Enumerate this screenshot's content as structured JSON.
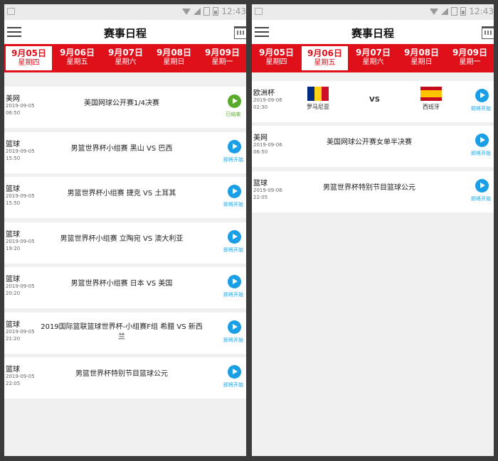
{
  "status": {
    "time": "12:43"
  },
  "header": {
    "title": "赛事日程"
  },
  "date_tabs": [
    {
      "date": "9月05日",
      "weekday": "星期四"
    },
    {
      "date": "9月06日",
      "weekday": "星期五"
    },
    {
      "date": "9月07日",
      "weekday": "星期六"
    },
    {
      "date": "9月08日",
      "weekday": "星期日"
    },
    {
      "date": "9月09日",
      "weekday": "星期一"
    }
  ],
  "left": {
    "active_tab": 0,
    "events": [
      {
        "sport": "美网",
        "date": "2019-09-05",
        "time": "06:50",
        "title": "美国网球公开赛1/4决赛",
        "status": "已结束"
      },
      {
        "sport": "篮球",
        "date": "2019-09-05",
        "time": "15:50",
        "title": "男篮世界杯小组赛 黑山 VS 巴西",
        "status": "即将开始"
      },
      {
        "sport": "篮球",
        "date": "2019-09-05",
        "time": "15:50",
        "title": "男篮世界杯小组赛 捷克 VS 土耳其",
        "status": "即将开始"
      },
      {
        "sport": "篮球",
        "date": "2019-09-05",
        "time": "19:20",
        "title": "男篮世界杯小组赛 立陶宛 VS 澳大利亚",
        "status": "即将开始"
      },
      {
        "sport": "篮球",
        "date": "2019-09-05",
        "time": "20:20",
        "title": "男篮世界杯小组赛 日本 VS 美国",
        "status": "即将开始"
      },
      {
        "sport": "篮球",
        "date": "2019-09-05",
        "time": "21:20",
        "title": "2019国际篮联篮球世界杯-小组赛F组 希腊 VS 新西兰",
        "status": "即将开始"
      },
      {
        "sport": "篮球",
        "date": "2019-09-05",
        "time": "22:05",
        "title": "男篮世界杯特别节目篮球公元",
        "status": "即将开始"
      }
    ]
  },
  "right": {
    "active_tab": 1,
    "match": {
      "sport": "欧洲杯",
      "date": "2019-09-06",
      "time": "02:30",
      "home": "罗马尼亚",
      "away": "西班牙",
      "vs": "VS",
      "status": "即将开始",
      "home_colors": [
        "#002b7f",
        "#fcd116",
        "#ce1126"
      ],
      "away_colors": [
        "#c60b1e",
        "#ffc400",
        "#c60b1e"
      ]
    },
    "events": [
      {
        "sport": "美网",
        "date": "2019-09-06",
        "time": "06:50",
        "title": "美国网球公开赛女单半决赛",
        "status": "即将开始"
      },
      {
        "sport": "篮球",
        "date": "2019-09-06",
        "time": "22:05",
        "title": "男篮世界杯特别节目篮球公元",
        "status": "即将开始"
      }
    ]
  }
}
